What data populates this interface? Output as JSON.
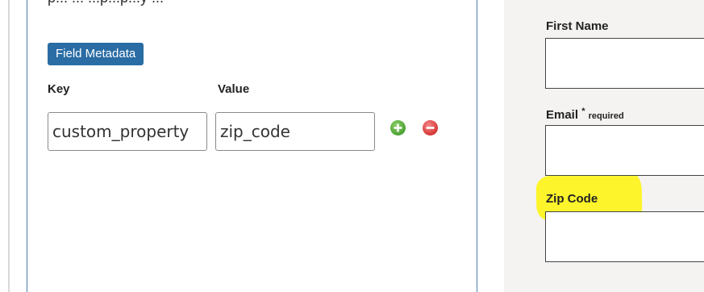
{
  "editor": {
    "cut_text": "p... ... ...p...p...y ...",
    "section_badge": "Field Metadata",
    "columns": {
      "key_label": "Key",
      "value_label": "Value"
    },
    "metadata_row": {
      "key_value": "custom_property",
      "value_value": "zip_code"
    },
    "icons": {
      "add": "plus-circle-icon",
      "remove": "minus-circle-icon"
    }
  },
  "preview": {
    "fields": {
      "first_name": {
        "label": "First Name"
      },
      "email": {
        "label": "Email",
        "required_marker": "*",
        "required_text": "required"
      },
      "zip_code": {
        "label": "Zip Code"
      }
    },
    "highlight_color": "#fff400"
  },
  "colors": {
    "badge": "#2a6ca4",
    "panel_border": "#4a7fb0",
    "add_icon": "#4fa536",
    "remove_icon": "#d93a3a",
    "preview_bg": "#f4f3f1"
  }
}
